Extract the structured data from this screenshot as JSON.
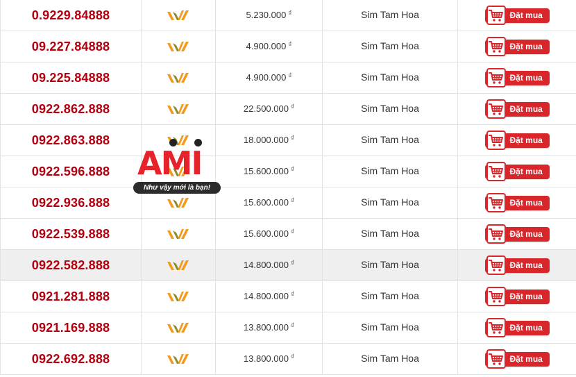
{
  "buy_label": "Đặt mua",
  "currency_symbol": "₫",
  "colors": {
    "number_red": "#b3000f",
    "button_red": "#d8262b",
    "logo_orange": "#f39a1e",
    "row_highlight": "#efefef"
  },
  "network_icon": "viettel-logo-icon",
  "cart_icon": "shopping-cart-icon",
  "rows": [
    {
      "number": "0.9229.84888",
      "price": "5.230.000",
      "type": "Sim Tam Hoa"
    },
    {
      "number": "09.227.84888",
      "price": "4.900.000",
      "type": "Sim Tam Hoa"
    },
    {
      "number": "09.225.84888",
      "price": "4.900.000",
      "type": "Sim Tam Hoa"
    },
    {
      "number": "0922.862.888",
      "price": "22.500.000",
      "type": "Sim Tam Hoa"
    },
    {
      "number": "0922.863.888",
      "price": "18.000.000",
      "type": "Sim Tam Hoa"
    },
    {
      "number": "0922.596.888",
      "price": "15.600.000",
      "type": "Sim Tam Hoa"
    },
    {
      "number": "0922.936.888",
      "price": "15.600.000",
      "type": "Sim Tam Hoa"
    },
    {
      "number": "0922.539.888",
      "price": "15.600.000",
      "type": "Sim Tam Hoa"
    },
    {
      "number": "0922.582.888",
      "price": "14.800.000",
      "type": "Sim Tam Hoa",
      "highlighted": true
    },
    {
      "number": "0921.281.888",
      "price": "14.800.000",
      "type": "Sim Tam Hoa"
    },
    {
      "number": "0921.169.888",
      "price": "13.800.000",
      "type": "Sim Tam Hoa"
    },
    {
      "number": "0922.692.888",
      "price": "13.800.000",
      "type": "Sim Tam Hoa"
    }
  ],
  "watermark": {
    "brand": "AMI",
    "tagline": "Như vậy mới là bạn!"
  }
}
